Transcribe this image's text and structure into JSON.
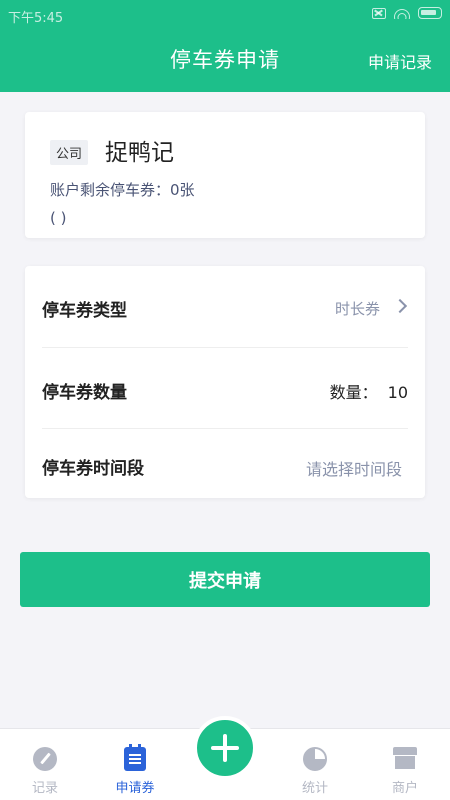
{
  "status_bar": {
    "time": "下午5:45"
  },
  "header": {
    "title": "停车券申请",
    "records_link": "申请记录"
  },
  "company_card": {
    "tag": "公司",
    "name": "捉鸭记",
    "balance": "账户剩余停车券：0张",
    "note": "( )"
  },
  "form": {
    "type": {
      "label": "停车券类型",
      "value": "时长券"
    },
    "quantity": {
      "label": "停车券数量",
      "prefix": "数量：",
      "value": "10"
    },
    "period": {
      "label": "停车券时间段",
      "placeholder": "请选择时间段"
    }
  },
  "submit_label": "提交申请",
  "tabbar": {
    "items": [
      {
        "label": "记录",
        "icon": "pencil-icon"
      },
      {
        "label": "申请券",
        "icon": "document-icon",
        "active": true
      },
      {
        "label": "统计",
        "icon": "pie-chart-icon"
      },
      {
        "label": "商户",
        "icon": "store-icon"
      }
    ],
    "center_icon": "plus-icon"
  },
  "colors": {
    "primary": "#1dbf8a",
    "active_tab": "#2b63d9",
    "muted": "#8a93ab"
  }
}
